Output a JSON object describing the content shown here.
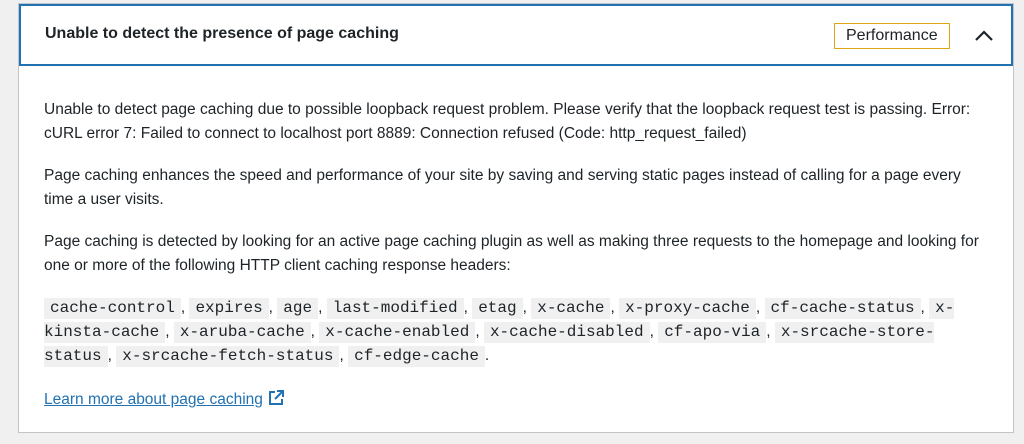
{
  "panel": {
    "title": "Unable to detect the presence of page caching",
    "badge": "Performance",
    "toggle_icon": "chevron-up-icon",
    "colors": {
      "accent": "#2271b1",
      "badge_border": "#dba617"
    }
  },
  "body": {
    "paragraphs": [
      "Unable to detect page caching due to possible loopback request problem. Please verify that the loopback request test is passing. Error: cURL error 7: Failed to connect to localhost port 8889: Connection refused (Code: http_request_failed)",
      "Page caching enhances the speed and performance of your site by saving and serving static pages instead of calling for a page every time a user visits.",
      "Page caching is detected by looking for an active page caching plugin as well as making three requests to the homepage and looking for one or more of the following HTTP client caching response headers:"
    ],
    "headers": [
      "cache-control",
      "expires",
      "age",
      "last-modified",
      "etag",
      "x-cache",
      "x-proxy-cache",
      "cf-cache-status",
      "x-kinsta-cache",
      "x-aruba-cache",
      "x-cache-enabled",
      "x-cache-disabled",
      "cf-apo-via",
      "x-srcache-store-status",
      "x-srcache-fetch-status",
      "cf-edge-cache"
    ],
    "separator": ",",
    "terminator": ".",
    "link_text": "Learn more about page caching",
    "link_icon": "external-link-icon"
  }
}
